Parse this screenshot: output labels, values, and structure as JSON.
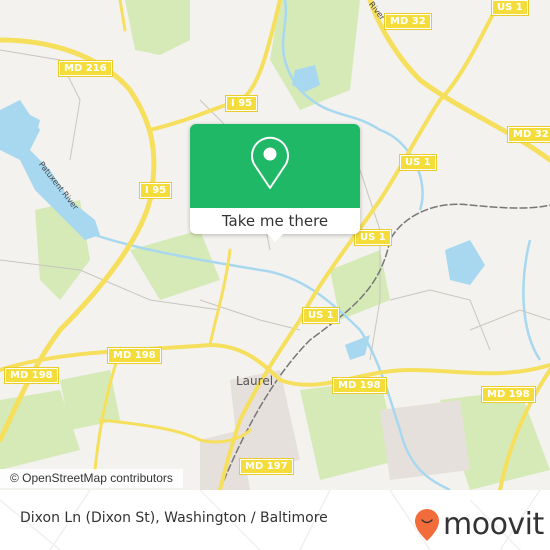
{
  "map": {
    "attribution": "© OpenStreetMap contributors",
    "place_labels": {
      "laurel": "Laurel"
    },
    "water_labels": {
      "patuxent": "Patuxent River",
      "river_top": "River"
    },
    "road_shields": {
      "md216": "MD 216",
      "i95_a": "I 95",
      "i95_b": "I 95",
      "md32_a": "MD 32",
      "md32_b": "MD 32",
      "us1_a": "US 1",
      "us1_b": "US 1",
      "us1_c": "US 1",
      "us1_d": "US 1",
      "md198_a": "MD 198",
      "md198_b": "MD 198",
      "md198_c": "MD 198",
      "md198_d": "MD 198",
      "md197": "MD 197"
    },
    "colors": {
      "land": "#f3f2ee",
      "water": "#a8d8f0",
      "park": "#d6eab7",
      "road": "#f6df5d",
      "rail": "#777777"
    }
  },
  "popup": {
    "button_label": "Take me there",
    "icon": "map-pin-icon",
    "color": "#1eb866"
  },
  "footer": {
    "location_title": "Dixon Ln (Dixon St), Washington / Baltimore",
    "brand": "moovit",
    "brand_color": "#f26b3a"
  }
}
